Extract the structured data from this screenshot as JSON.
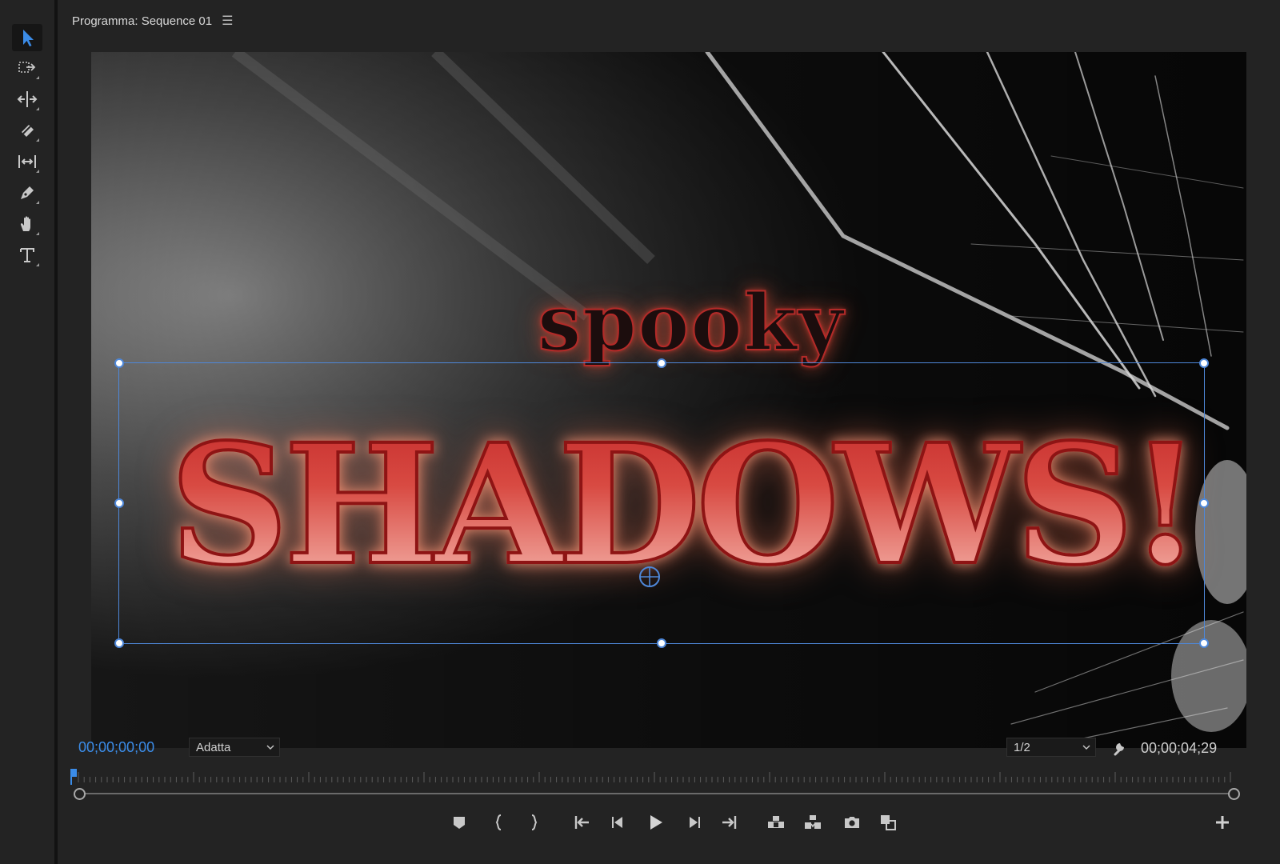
{
  "panel": {
    "title": "Programma: Sequence 01",
    "menu_icon": "hamburger-menu-icon"
  },
  "toolbar": {
    "tools": [
      {
        "name": "selection-tool",
        "icon": "arrow-cursor-icon",
        "active": true
      },
      {
        "name": "track-select-tool",
        "icon": "track-select-icon"
      },
      {
        "name": "ripple-edit-tool",
        "icon": "ripple-edit-icon"
      },
      {
        "name": "razor-tool",
        "icon": "razor-icon"
      },
      {
        "name": "slip-tool",
        "icon": "slip-icon"
      },
      {
        "name": "pen-tool",
        "icon": "pen-icon"
      },
      {
        "name": "hand-tool",
        "icon": "hand-icon"
      },
      {
        "name": "type-tool",
        "icon": "type-icon"
      }
    ]
  },
  "viewer": {
    "title_line1": "spooky",
    "title_line2": "SHADOWS!"
  },
  "controls": {
    "current_timecode": "00;00;00;00",
    "fit_value": "Adatta",
    "resolution_value": "1/2",
    "duration_timecode": "00;00;04;29"
  },
  "colors": {
    "accent": "#3b8ce8",
    "selection": "#4e87d8",
    "title_red": "#c42a2a"
  }
}
